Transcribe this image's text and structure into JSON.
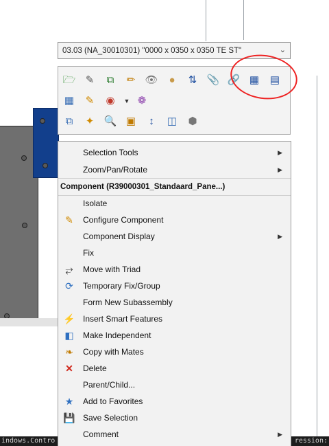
{
  "config_dropdown": {
    "value": "03.03 (NA_30010301)  \"0000 x 0350 x 0350 TE ST\""
  },
  "toolbar": {
    "row1": [
      "open-part-icon",
      "edit-appearance-icon",
      "replace-icon",
      "edit-component-icon",
      "hide-icon",
      "isolate-icon",
      "mate-icon",
      "attach-icon",
      "link-icon",
      "properties-icon",
      "edit-properties-icon"
    ],
    "row2": [
      "component-display-icon",
      "configure-icon",
      "appearance-icon",
      "appearance-dropdown-icon",
      "color-wheel-icon"
    ],
    "row3": [
      "select-component-icon",
      "smart-select-icon",
      "zoom-to-selection-icon",
      "view-icon",
      "move-triad-icon",
      "section-view-icon",
      "box-select-icon"
    ]
  },
  "menu": {
    "top_items": [
      {
        "label": "Selection Tools",
        "submenu": true
      },
      {
        "label": "Zoom/Pan/Rotate",
        "submenu": true
      }
    ],
    "header": "Component (R39000301_Standaard_Pane...)",
    "items": [
      {
        "label": "Isolate",
        "icon": "",
        "submenu": false
      },
      {
        "label": "Configure Component",
        "icon": "configure-pencil-icon",
        "submenu": false
      },
      {
        "label": "Component Display",
        "icon": "",
        "submenu": true
      },
      {
        "label": "Fix",
        "icon": "",
        "submenu": false
      },
      {
        "label": "Move with Triad",
        "icon": "triad-icon",
        "submenu": false
      },
      {
        "label": "Temporary Fix/Group",
        "icon": "temporary-fix-icon",
        "submenu": false
      },
      {
        "label": "Form New Subassembly",
        "icon": "",
        "submenu": false
      },
      {
        "label": "Insert Smart Features",
        "icon": "smart-features-icon",
        "submenu": false
      },
      {
        "label": "Make Independent",
        "icon": "make-independent-icon",
        "submenu": false
      },
      {
        "label": "Copy with Mates",
        "icon": "copy-with-mates-icon",
        "submenu": false
      },
      {
        "label": "Delete",
        "icon": "delete-x-icon",
        "submenu": false
      },
      {
        "label": "Parent/Child...",
        "icon": "",
        "submenu": false
      },
      {
        "label": "Add to Favorites",
        "icon": "favorites-star-icon",
        "submenu": false
      },
      {
        "label": "Save Selection",
        "icon": "save-selection-icon",
        "submenu": false
      },
      {
        "label": "Comment",
        "icon": "",
        "submenu": true
      }
    ]
  },
  "status": {
    "left_text": "indows.Contro",
    "right_text": "ression:"
  },
  "colors": {
    "annotation": "#e22222",
    "part_blue": "#123f8c",
    "part_gray": "#6f6f6f"
  }
}
